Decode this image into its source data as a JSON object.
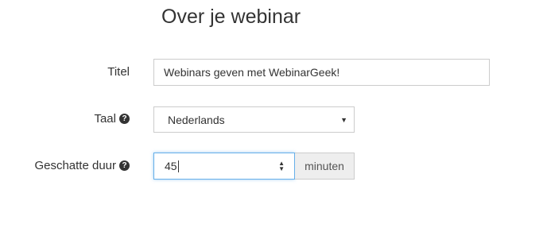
{
  "section": {
    "title": "Over je webinar"
  },
  "fields": {
    "titel": {
      "label": "Titel",
      "value": "Webinars geven met WebinarGeek!"
    },
    "taal": {
      "label": "Taal",
      "selected": "Nederlands"
    },
    "duur": {
      "label": "Geschatte duur",
      "value": "45",
      "unit": "minuten"
    }
  },
  "icons": {
    "help": "?",
    "caret": "▼",
    "spin_up": "▲",
    "spin_down": "▼"
  }
}
